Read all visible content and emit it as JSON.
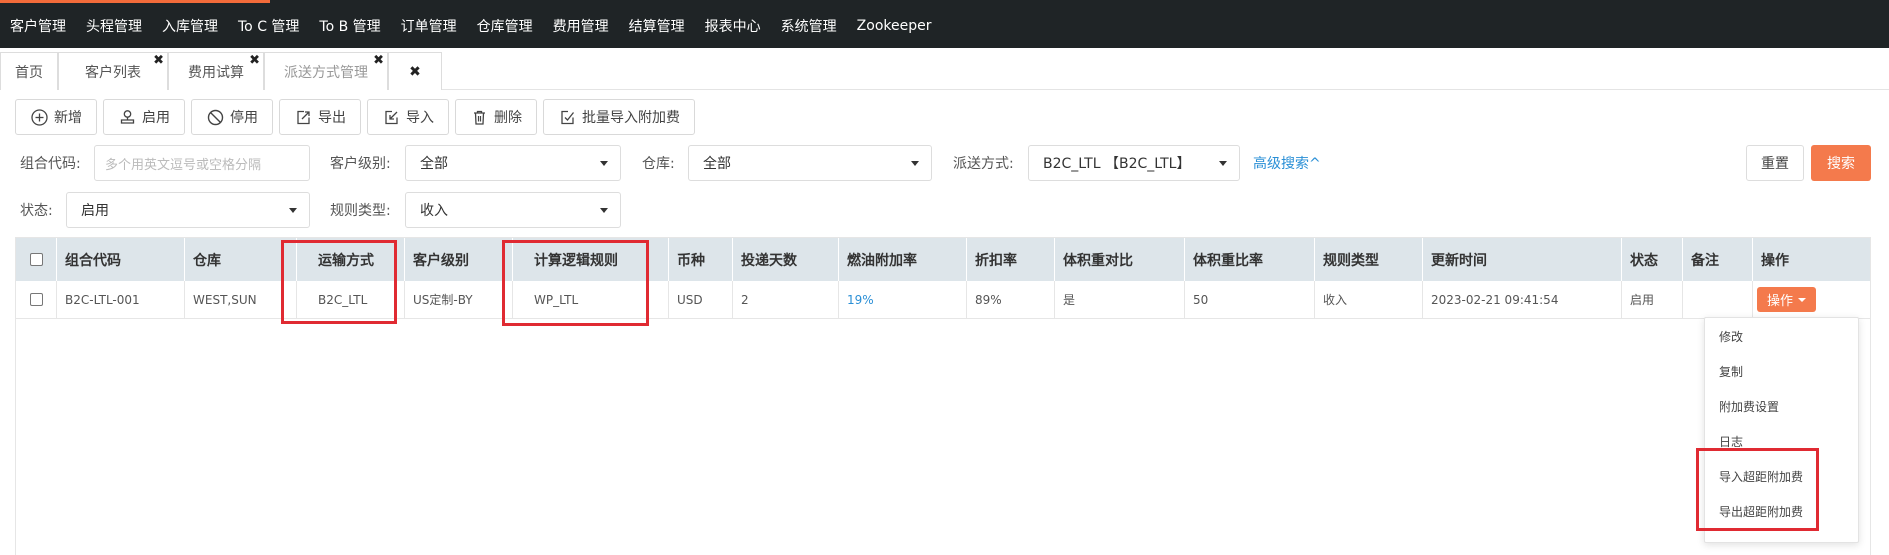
{
  "nav": {
    "items": [
      "客户管理",
      "头程管理",
      "入库管理",
      "To C 管理",
      "To B 管理",
      "订单管理",
      "仓库管理",
      "费用管理",
      "结算管理",
      "报表中心",
      "系统管理",
      "Zookeeper"
    ]
  },
  "tabs": [
    {
      "label": "首页"
    },
    {
      "label": "客户列表",
      "close": "✖"
    },
    {
      "label": "费用试算",
      "close": "✖"
    },
    {
      "label": "派送方式管理",
      "close": "✖"
    },
    {
      "label": "✖"
    }
  ],
  "toolbar": {
    "buttons": [
      "新增",
      "启用",
      "停用",
      "导出",
      "导入",
      "删除",
      "批量导入附加费"
    ]
  },
  "filters": {
    "combo_code_label": "组合代码:",
    "combo_code_placeholder": "多个用英文逗号或空格分隔",
    "customer_level_label": "客户级别:",
    "customer_level_value": "全部",
    "warehouse_label": "仓库:",
    "warehouse_value": "全部",
    "delivery_label": "派送方式:",
    "delivery_value": "B2C_LTL 【B2C_LTL】",
    "advanced_label": "高级搜索^",
    "status_label": "状态:",
    "status_value": "启用",
    "rule_type_label": "规则类型:",
    "rule_type_value": "收入",
    "reset_label": "重置",
    "search_label": "搜索"
  },
  "table": {
    "headers": [
      "组合代码",
      "仓库",
      "运输方式",
      "客户级别",
      "计算逻辑规则",
      "币种",
      "投递天数",
      "燃油附加率",
      "折扣率",
      "体积重对比",
      "体积重比率",
      "规则类型",
      "更新时间",
      "状态",
      "备注",
      "操作"
    ],
    "rows": [
      [
        "B2C-LTL-001",
        "WEST,SUN",
        "B2C_LTL",
        "US定制-BY",
        "WP_LTL",
        "USD",
        "2",
        "19%",
        "89%",
        "是",
        "50",
        "收入",
        "2023-02-21 09:41:54",
        "启用",
        "",
        "操作"
      ]
    ]
  },
  "dropdown": {
    "items": [
      "修改",
      "复制",
      "附加费设置",
      "日志",
      "导入超距附加费",
      "导出超距附加费"
    ]
  },
  "colors": {
    "nav_bg": "#1f2426",
    "accent": "#f26b3a",
    "primary_button": "#f47a4c",
    "link": "#2a8fd6",
    "highlight": "#e02a32",
    "table_header_bg": "#dde5ea"
  }
}
